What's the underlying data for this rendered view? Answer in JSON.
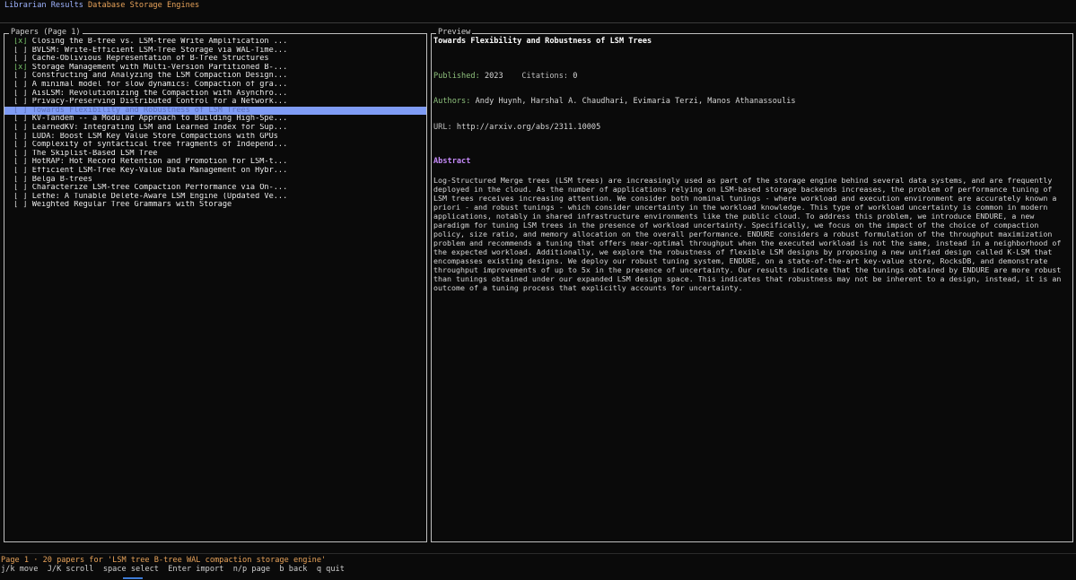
{
  "app": {
    "title": "Librarian Results",
    "tab": "Database Storage Engines"
  },
  "papers_pane": {
    "label": "Papers (Page 1)",
    "items": [
      {
        "checked": true,
        "title": "Closing the B-tree vs. LSM-tree Write Amplification ..."
      },
      {
        "checked": false,
        "title": "BVLSM: Write-Efficient LSM-Tree Storage via WAL-Time..."
      },
      {
        "checked": false,
        "title": "Cache-Oblivious Representation of B-Tree Structures"
      },
      {
        "checked": true,
        "title": "Storage Management with Multi-Version Partitioned B-..."
      },
      {
        "checked": false,
        "title": "Constructing and Analyzing the LSM Compaction Design..."
      },
      {
        "checked": false,
        "title": "A minimal model for slow dynamics: Compaction of gra..."
      },
      {
        "checked": false,
        "title": "AisLSM: Revolutionizing the Compaction with Asynchro..."
      },
      {
        "checked": false,
        "title": "Privacy-Preserving Distributed Control for a Network..."
      },
      {
        "checked": false,
        "title": "Towards Flexibility and Robustness of LSM Trees",
        "selected": true
      },
      {
        "checked": false,
        "title": "KV-Tandem -- a Modular Approach to Building High-Spe..."
      },
      {
        "checked": false,
        "title": "LearnedKV: Integrating LSM and Learned Index for Sup..."
      },
      {
        "checked": false,
        "title": "LUDA: Boost LSM Key Value Store Compactions with GPUs"
      },
      {
        "checked": false,
        "title": "Complexity of syntactical tree fragments of Independ..."
      },
      {
        "checked": false,
        "title": "The Skiplist-Based LSM Tree"
      },
      {
        "checked": false,
        "title": "HotRAP: Hot Record Retention and Promotion for LSM-t..."
      },
      {
        "checked": false,
        "title": "Efficient LSM-Tree Key-Value Data Management on Hybr..."
      },
      {
        "checked": false,
        "title": "Belga B-trees"
      },
      {
        "checked": false,
        "title": "Characterize LSM-tree Compaction Performance via On-..."
      },
      {
        "checked": false,
        "title": "Lethe: A Tunable Delete-Aware LSM Engine (Updated Ve..."
      },
      {
        "checked": false,
        "title": "Weighted Regular Tree Grammars with Storage"
      }
    ]
  },
  "preview": {
    "label": "Preview",
    "title": "Towards Flexibility and Robustness of LSM Trees",
    "published_label": "Published:",
    "published": "2023",
    "citations_label": "Citations:",
    "citations": "0",
    "authors_label": "Authors:",
    "authors": "Andy Huynh, Harshal A. Chaudhari, Evimaria Terzi, Manos Athanassoulis",
    "url_label": "URL:",
    "url": "http://arxiv.org/abs/2311.10005",
    "abstract_heading": "Abstract",
    "abstract": "Log-Structured Merge trees (LSM trees) are increasingly used as part of the storage engine behind several data systems, and are frequently deployed in the cloud. As the number of applications relying on LSM-based storage backends increases, the problem of performance tuning of LSM trees receives increasing attention. We consider both nominal tunings - where workload and execution environment are accurately known a priori - and robust tunings - which consider uncertainty in the workload knowledge. This type of workload uncertainty is common in modern applications, notably in shared infrastructure environments like the public cloud. To address this problem, we introduce ENDURE, a new paradigm for tuning LSM trees in the presence of workload uncertainty. Specifically, we focus on the impact of the choice of compaction policy, size ratio, and memory allocation on the overall performance. ENDURE considers a robust formulation of the throughput maximization problem and recommends a tuning that offers near-optimal throughput when the executed workload is not the same, instead in a neighborhood of the expected workload. Additionally, we explore the robustness of flexible LSM designs by proposing a new unified design called K-LSM that encompasses existing designs. We deploy our robust tuning system, ENDURE, on a state-of-the-art key-value store, RocksDB, and demonstrate throughput improvements of up to 5x in the presence of uncertainty. Our results indicate that the tunings obtained by ENDURE are more robust than tunings obtained under our expanded LSM design space. This indicates that robustness may not be inherent to a design, instead, it is an outcome of a tuning process that explicitly accounts for uncertainty."
  },
  "footer": {
    "status": "Page 1 · 20 papers for 'LSM tree B-tree WAL compaction storage engine'",
    "keys": "j/k move  J/K scroll  space select  Enter import  n/p page  b back  q quit"
  },
  "colors": {
    "selection": "#7f9cf5",
    "accent_orange": "#e8a35a",
    "accent_purple": "#c58af9",
    "accent_green": "#8ec07c"
  }
}
